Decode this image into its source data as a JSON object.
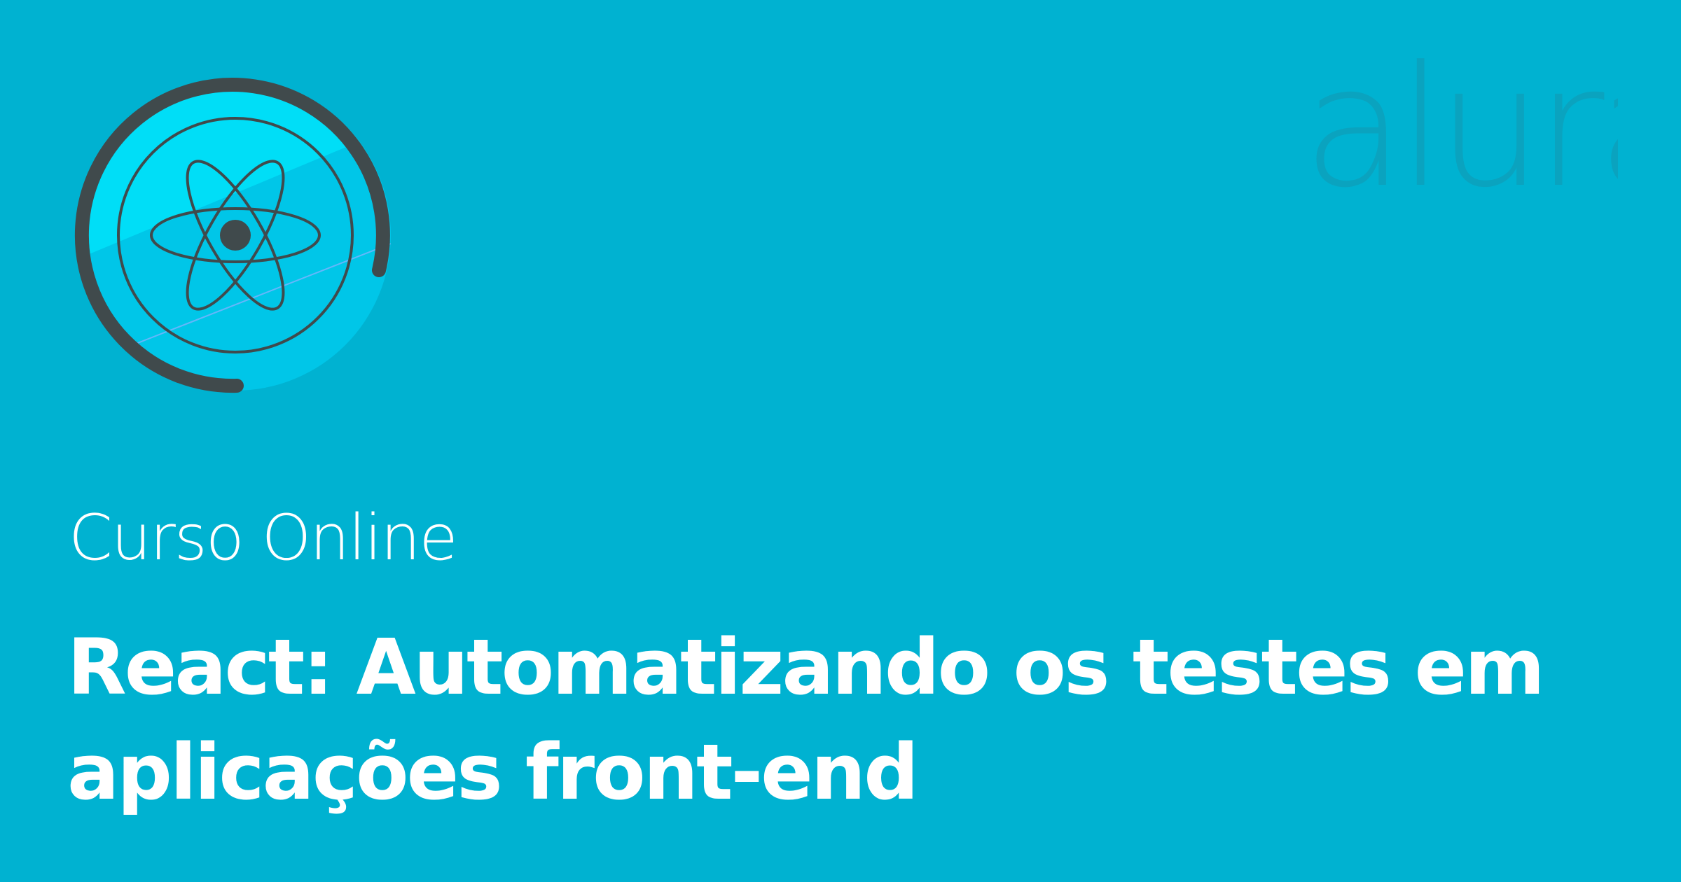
{
  "brand": {
    "logo_text": "alura",
    "logo_color": "#0aa3bf"
  },
  "course": {
    "type_label": "Curso Online",
    "title_line1": "React: Automatizando os testes em",
    "title_line2": "aplicações front-end"
  },
  "badge": {
    "icon": "react-atom-icon",
    "colors": {
      "ring": "#404a4c",
      "disc": "#00c6e8",
      "disc_highlight": "#00def7",
      "background": "#00b2d1"
    }
  }
}
